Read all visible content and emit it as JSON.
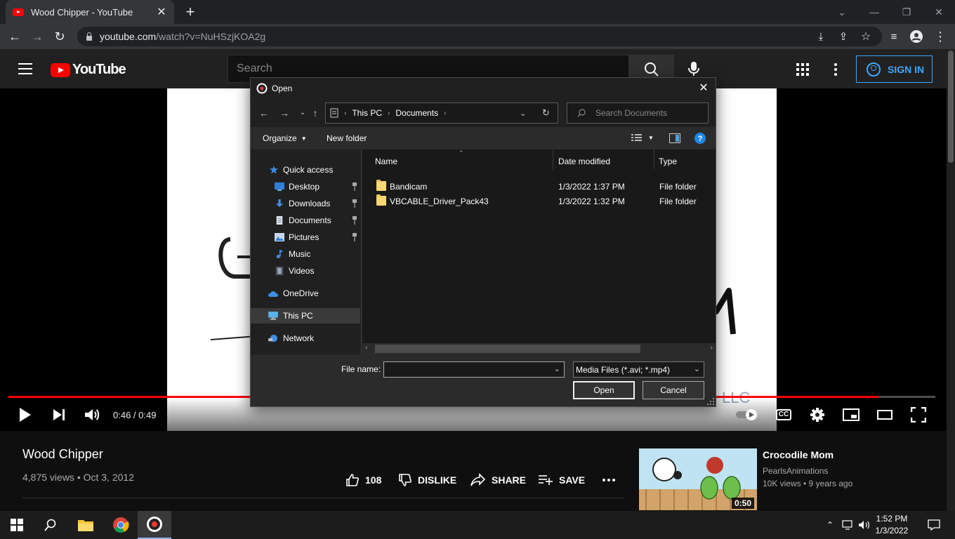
{
  "browser": {
    "tab_title": "Wood Chipper - YouTube",
    "url_host": "youtube.com",
    "url_path": "/watch?v=NuHSzjKOA2g"
  },
  "youtube": {
    "logo_text": "YouTube",
    "search_placeholder": "Search",
    "signin_label": "SIGN IN"
  },
  "player": {
    "time_text": "0:46 / 0:49",
    "progress": 0.939,
    "cc_label": "CC",
    "video_text": "LLC"
  },
  "video": {
    "title": "Wood Chipper",
    "meta": "4,875 views • Oct 3, 2012",
    "likes": "108",
    "dislike_label": "DISLIKE",
    "share_label": "SHARE",
    "save_label": "SAVE"
  },
  "recommendation": {
    "title": "Crocodile Mom",
    "channel": "PearlsAnimations",
    "meta": "10K views • 9 years ago",
    "duration": "0:50"
  },
  "dialog": {
    "title": "Open",
    "breadcrumb": [
      "This PC",
      "Documents"
    ],
    "search_placeholder": "Search Documents",
    "organize_label": "Organize",
    "new_folder_label": "New folder",
    "nav_items": [
      {
        "label": "Quick access",
        "icon": "star-icon"
      },
      {
        "label": "Desktop",
        "icon": "desktop-icon",
        "pinned": true
      },
      {
        "label": "Downloads",
        "icon": "download-icon",
        "pinned": true
      },
      {
        "label": "Documents",
        "icon": "document-icon",
        "pinned": true
      },
      {
        "label": "Pictures",
        "icon": "pictures-icon",
        "pinned": true
      },
      {
        "label": "Music",
        "icon": "music-icon"
      },
      {
        "label": "Videos",
        "icon": "videos-icon"
      },
      {
        "label": "OneDrive",
        "icon": "cloud-icon"
      },
      {
        "label": "This PC",
        "icon": "computer-icon",
        "selected": true
      },
      {
        "label": "Network",
        "icon": "network-icon"
      }
    ],
    "columns": {
      "name": "Name",
      "date": "Date modified",
      "type": "Type"
    },
    "files": [
      {
        "name": "Bandicam",
        "date": "1/3/2022 1:37 PM",
        "type": "File folder"
      },
      {
        "name": "VBCABLE_Driver_Pack43",
        "date": "1/3/2022 1:32 PM",
        "type": "File folder"
      }
    ],
    "file_name_label": "File name:",
    "file_name_value": "",
    "filter_value": "Media Files (*.avi; *.mp4)",
    "open_label": "Open",
    "cancel_label": "Cancel"
  },
  "taskbar": {
    "time": "1:52 PM",
    "date": "1/3/2022"
  },
  "colors": {
    "youtube_red": "#ff0000",
    "signin_blue": "#3ea6ff",
    "folder_yellow": "#f8d775"
  }
}
